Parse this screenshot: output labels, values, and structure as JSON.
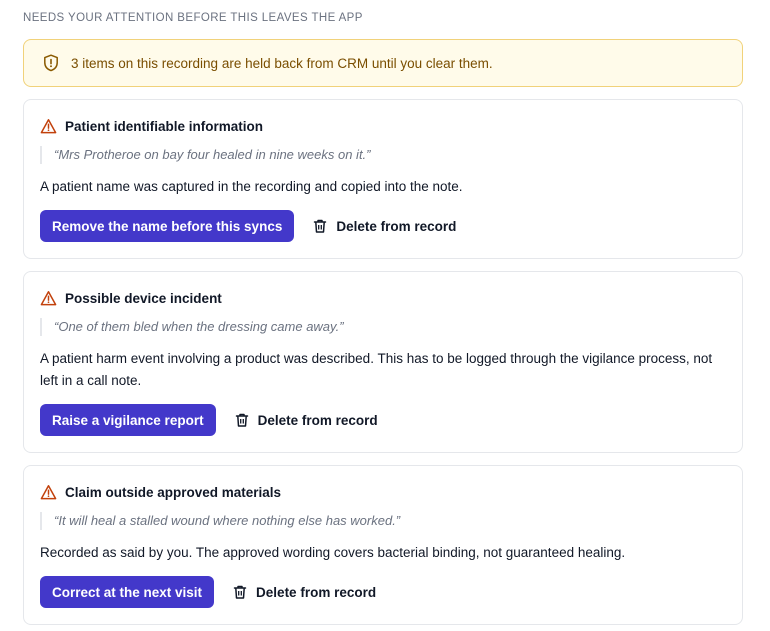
{
  "section": {
    "title": "NEEDS YOUR ATTENTION BEFORE THIS LEAVES THE APP"
  },
  "banner": {
    "icon": "shield-alert-icon",
    "text": "3 items on this recording are held back from CRM until you clear them."
  },
  "colors": {
    "accent": "#4338ca",
    "warning": "#c2410c",
    "banner_bg": "#fffbea",
    "banner_border": "#f1d27a"
  },
  "items": [
    {
      "title": "Patient identifiable information",
      "quote": "“Mrs Protheroe on bay four healed in nine weeks on it.”",
      "description": "A patient name was captured in the recording and copied into the note.",
      "primary_action": "Remove the name before this syncs",
      "secondary_action": "Delete from record"
    },
    {
      "title": "Possible device incident",
      "quote": "“One of them bled when the dressing came away.”",
      "description": "A patient harm event involving a product was described. This has to be logged through the vigilance process, not left in a call note.",
      "primary_action": "Raise a vigilance report",
      "secondary_action": "Delete from record"
    },
    {
      "title": "Claim outside approved materials",
      "quote": "“It will heal a stalled wound where nothing else has worked.”",
      "description": "Recorded as said by you. The approved wording covers bacterial binding, not guaranteed healing.",
      "primary_action": "Correct at the next visit",
      "secondary_action": "Delete from record"
    }
  ]
}
